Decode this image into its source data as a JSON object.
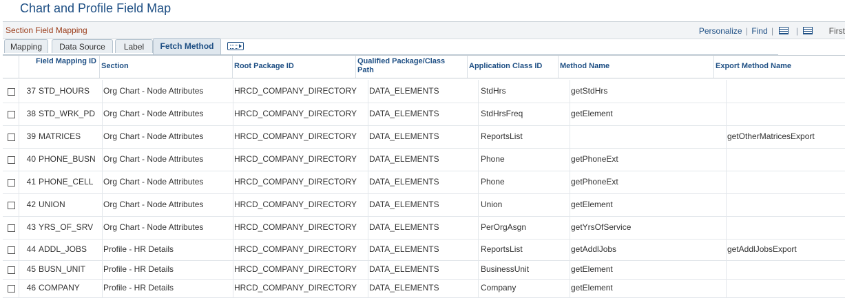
{
  "page": {
    "title": "Chart and Profile Field Map"
  },
  "grid": {
    "title": "Section Field Mapping",
    "personalize": "Personalize",
    "find": "Find",
    "first": "First"
  },
  "tabs": [
    {
      "label": "Mapping",
      "active": false
    },
    {
      "label": "Data Source",
      "active": false
    },
    {
      "label": "Label",
      "active": false
    },
    {
      "label": "Fetch Method",
      "active": true
    }
  ],
  "columns": {
    "field_mapping_id": "Field Mapping ID",
    "section": "Section",
    "root_package_id": "Root Package ID",
    "qualified_path": "Qualified Package/Class Path",
    "app_class_id": "Application Class ID",
    "method_name": "Method Name",
    "export_method_name": "Export Method Name"
  },
  "rows": [
    {
      "num": "37",
      "field": "STD_HOURS",
      "section": "Org Chart - Node Attributes",
      "root": "HRCD_COMPANY_DIRECTORY",
      "path": "DATA_ELEMENTS",
      "appclass": "StdHrs",
      "method": "getStdHrs",
      "export": ""
    },
    {
      "num": "38",
      "field": "STD_WRK_PD",
      "section": "Org Chart - Node Attributes",
      "root": "HRCD_COMPANY_DIRECTORY",
      "path": "DATA_ELEMENTS",
      "appclass": "StdHrsFreq",
      "method": "getElement",
      "export": ""
    },
    {
      "num": "39",
      "field": "MATRICES",
      "section": "Org Chart - Node Attributes",
      "root": "HRCD_COMPANY_DIRECTORY",
      "path": "DATA_ELEMENTS",
      "appclass": "ReportsList",
      "method": "",
      "export": "getOtherMatricesExport"
    },
    {
      "num": "40",
      "field": "PHONE_BUSN",
      "section": "Org Chart - Node Attributes",
      "root": "HRCD_COMPANY_DIRECTORY",
      "path": "DATA_ELEMENTS",
      "appclass": "Phone",
      "method": "getPhoneExt",
      "export": ""
    },
    {
      "num": "41",
      "field": "PHONE_CELL",
      "section": "Org Chart - Node Attributes",
      "root": "HRCD_COMPANY_DIRECTORY",
      "path": "DATA_ELEMENTS",
      "appclass": "Phone",
      "method": "getPhoneExt",
      "export": ""
    },
    {
      "num": "42",
      "field": "UNION",
      "section": "Org Chart - Node Attributes",
      "root": "HRCD_COMPANY_DIRECTORY",
      "path": "DATA_ELEMENTS",
      "appclass": "Union",
      "method": "getElement",
      "export": ""
    },
    {
      "num": "43",
      "field": "YRS_OF_SRV",
      "section": "Org Chart - Node Attributes",
      "root": "HRCD_COMPANY_DIRECTORY",
      "path": "DATA_ELEMENTS",
      "appclass": "PerOrgAsgn",
      "method": "getYrsOfService",
      "export": ""
    },
    {
      "num": "44",
      "field": "ADDL_JOBS",
      "section": "Profile - HR Details",
      "root": "HRCD_COMPANY_DIRECTORY",
      "path": "DATA_ELEMENTS",
      "appclass": "ReportsList",
      "method": "getAddlJobs",
      "export": "getAddlJobsExport"
    },
    {
      "num": "45",
      "field": "BUSN_UNIT",
      "section": "Profile - HR Details",
      "root": "HRCD_COMPANY_DIRECTORY",
      "path": "DATA_ELEMENTS",
      "appclass": "BusinessUnit",
      "method": "getElement",
      "export": ""
    },
    {
      "num": "46",
      "field": "COMPANY",
      "section": "Profile - HR Details",
      "root": "HRCD_COMPANY_DIRECTORY",
      "path": "DATA_ELEMENTS",
      "appclass": "Company",
      "method": "getElement",
      "export": ""
    }
  ]
}
